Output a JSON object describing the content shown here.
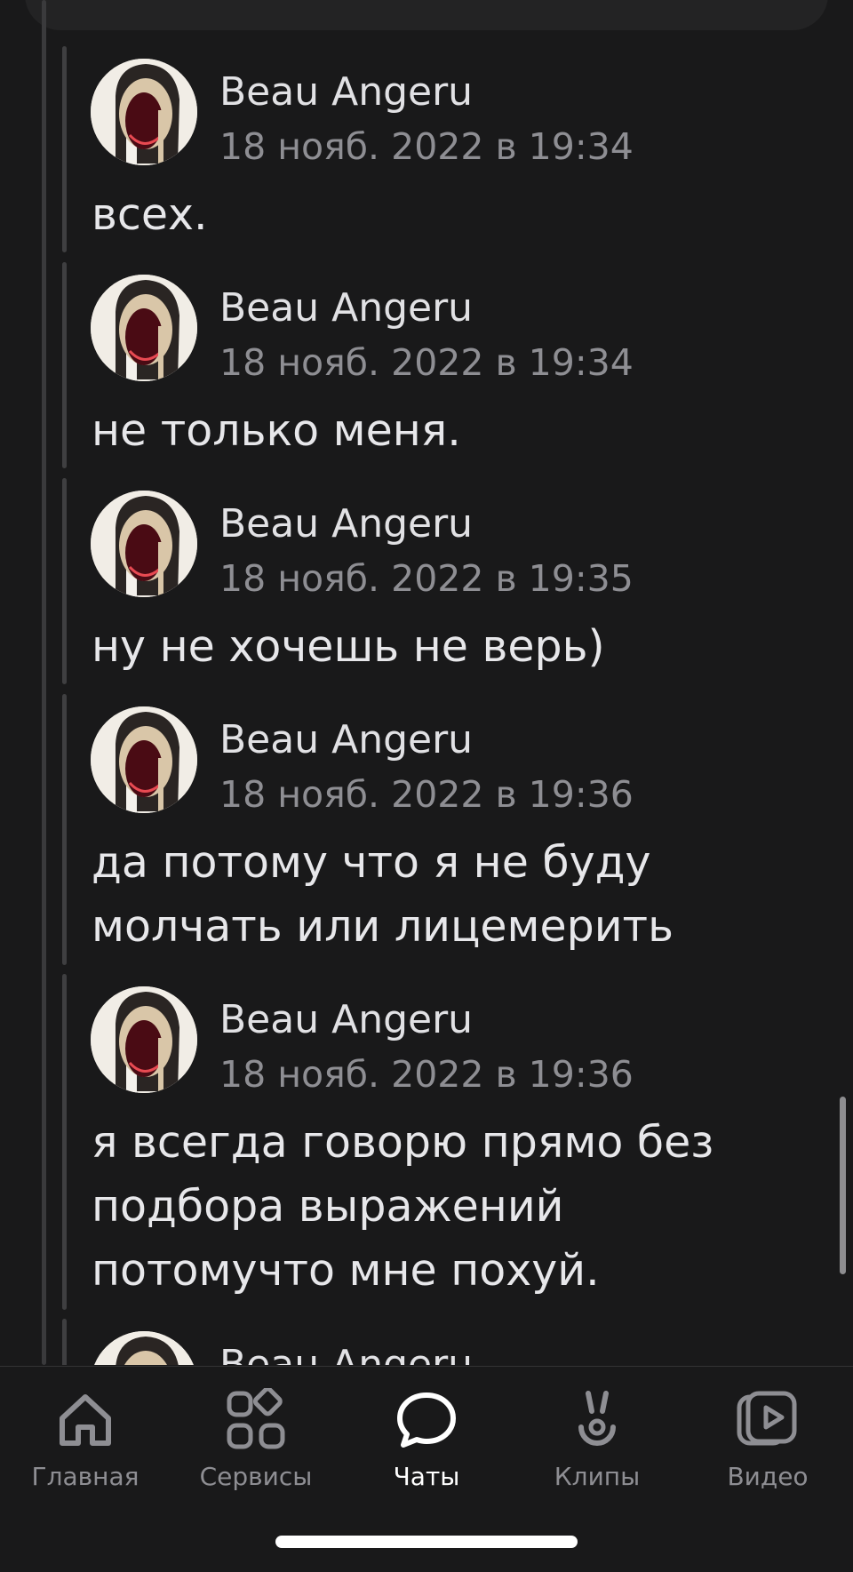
{
  "messages": [
    {
      "author": "Beau Angeru",
      "time": "18 нояб. 2022 в 19:34",
      "text": "всех."
    },
    {
      "author": "Beau Angeru",
      "time": "18 нояб. 2022 в 19:34",
      "text": "не только меня."
    },
    {
      "author": "Beau Angeru",
      "time": "18 нояб. 2022 в 19:35",
      "text": "ну не хочешь не верь)"
    },
    {
      "author": "Beau Angeru",
      "time": "18 нояб. 2022 в 19:36",
      "text": "да потому что я не буду\nмолчать или лицемерить"
    },
    {
      "author": "Beau Angeru",
      "time": "18 нояб. 2022 в 19:36",
      "text": "я всегда говорю прямо без\nподбора выражений\nпотомучто мне похуй."
    },
    {
      "author": "Beau Angeru",
      "time": "",
      "text": ""
    }
  ],
  "tabbar": {
    "items": [
      {
        "label": "Главная",
        "icon": "home-icon",
        "active": false
      },
      {
        "label": "Сервисы",
        "icon": "services-icon",
        "active": false
      },
      {
        "label": "Чаты",
        "icon": "chat-bubble-icon",
        "active": true
      },
      {
        "label": "Клипы",
        "icon": "clips-icon",
        "active": false
      },
      {
        "label": "Видео",
        "icon": "video-play-icon",
        "active": false
      }
    ]
  },
  "colors": {
    "background": "#19191a",
    "text_primary": "#e7e7ea",
    "text_secondary": "#8e8e93",
    "tab_active": "#ffffff"
  }
}
